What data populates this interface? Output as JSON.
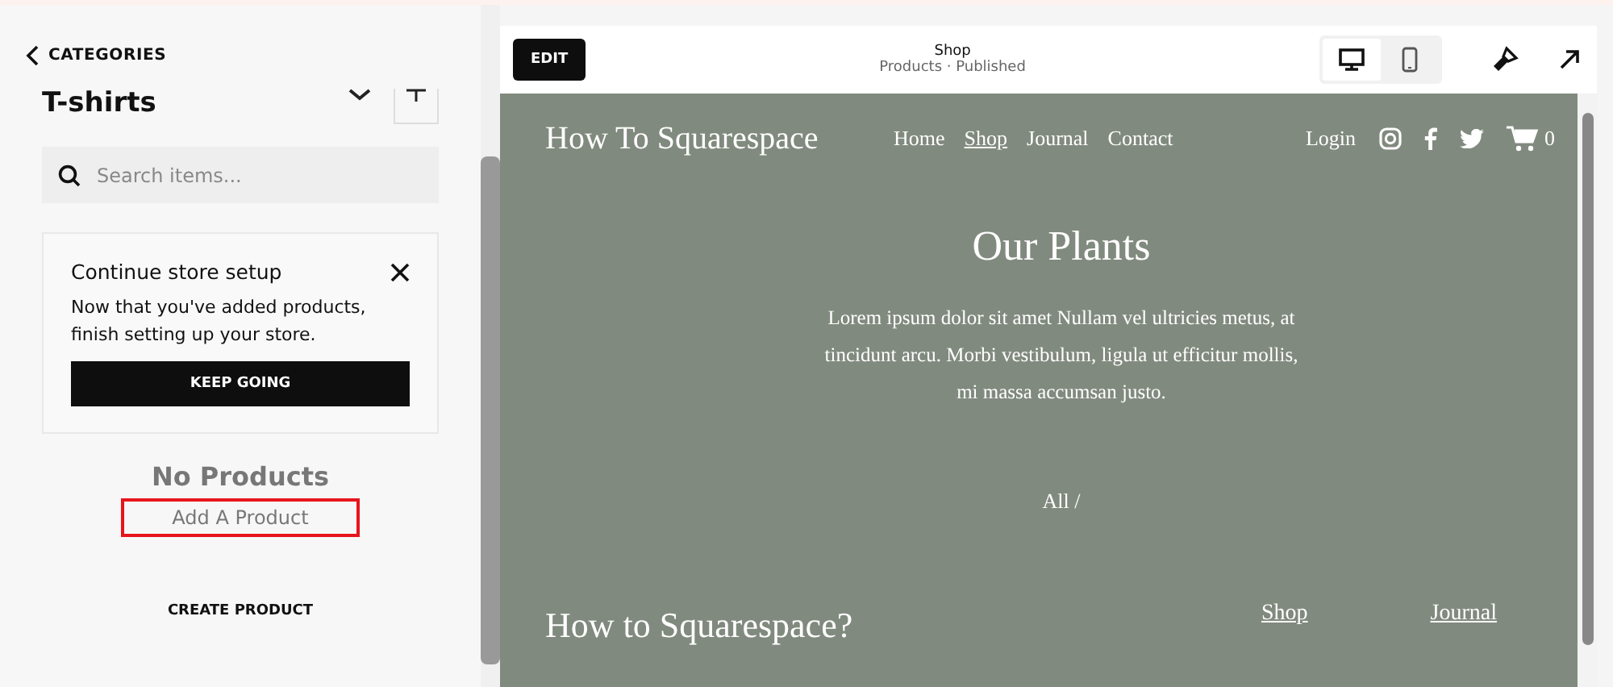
{
  "sidebar": {
    "back_link": "CATEGORIES",
    "heading": "T-shirts",
    "search": {
      "placeholder": "Search items..."
    },
    "setup_card": {
      "title": "Continue store setup",
      "text": "Now that you've added products, finish setting up your store.",
      "button": "KEEP GOING"
    },
    "empty_title": "No Products",
    "add_link": {
      "label": "Add A Product",
      "highlighted": true
    },
    "create_button": "CREATE PRODUCT"
  },
  "preview_bar": {
    "edit_button": "EDIT",
    "page_title": "Shop",
    "page_subtitle": "Products · Published",
    "devices": [
      {
        "kind": "desktop",
        "selected": true
      },
      {
        "kind": "mobile",
        "selected": false
      }
    ]
  },
  "site": {
    "logo": "How To Squarespace",
    "nav": [
      {
        "label": "Home",
        "selected": false
      },
      {
        "label": "Shop",
        "selected": true
      },
      {
        "label": "Journal",
        "selected": false
      },
      {
        "label": "Contact",
        "selected": false
      }
    ],
    "login": "Login",
    "cart_count": "0",
    "heading": "Our Plants",
    "intro": "Lorem ipsum dolor sit amet Nullam vel ultricies metus, at tincidunt arcu. Morbi vestibulum, ligula ut efficitur mollis, mi massa accumsan justo.",
    "filter": "All /",
    "footer_title": "How to Squarespace?",
    "footer_links": [
      "Shop",
      "Journal"
    ]
  }
}
